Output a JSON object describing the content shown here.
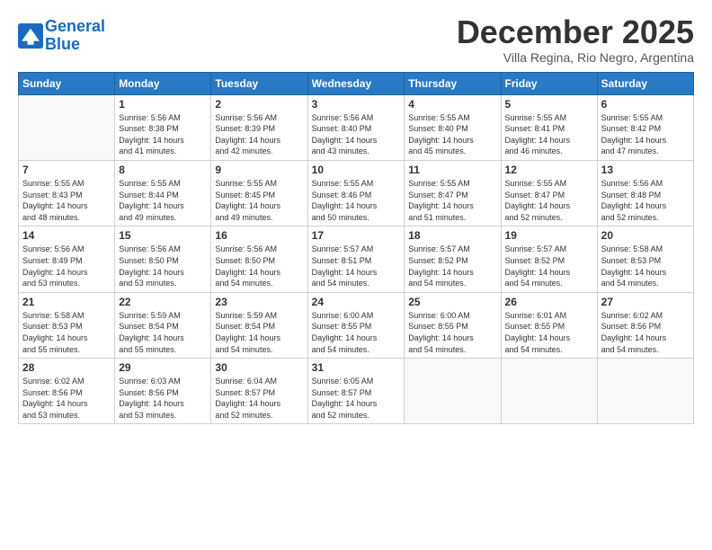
{
  "logo": {
    "line1": "General",
    "line2": "Blue"
  },
  "title": "December 2025",
  "subtitle": "Villa Regina, Rio Negro, Argentina",
  "header_days": [
    "Sunday",
    "Monday",
    "Tuesday",
    "Wednesday",
    "Thursday",
    "Friday",
    "Saturday"
  ],
  "weeks": [
    [
      {
        "day": "",
        "info": ""
      },
      {
        "day": "1",
        "info": "Sunrise: 5:56 AM\nSunset: 8:38 PM\nDaylight: 14 hours\nand 41 minutes."
      },
      {
        "day": "2",
        "info": "Sunrise: 5:56 AM\nSunset: 8:39 PM\nDaylight: 14 hours\nand 42 minutes."
      },
      {
        "day": "3",
        "info": "Sunrise: 5:56 AM\nSunset: 8:40 PM\nDaylight: 14 hours\nand 43 minutes."
      },
      {
        "day": "4",
        "info": "Sunrise: 5:55 AM\nSunset: 8:40 PM\nDaylight: 14 hours\nand 45 minutes."
      },
      {
        "day": "5",
        "info": "Sunrise: 5:55 AM\nSunset: 8:41 PM\nDaylight: 14 hours\nand 46 minutes."
      },
      {
        "day": "6",
        "info": "Sunrise: 5:55 AM\nSunset: 8:42 PM\nDaylight: 14 hours\nand 47 minutes."
      }
    ],
    [
      {
        "day": "7",
        "info": "Sunrise: 5:55 AM\nSunset: 8:43 PM\nDaylight: 14 hours\nand 48 minutes."
      },
      {
        "day": "8",
        "info": "Sunrise: 5:55 AM\nSunset: 8:44 PM\nDaylight: 14 hours\nand 49 minutes."
      },
      {
        "day": "9",
        "info": "Sunrise: 5:55 AM\nSunset: 8:45 PM\nDaylight: 14 hours\nand 49 minutes."
      },
      {
        "day": "10",
        "info": "Sunrise: 5:55 AM\nSunset: 8:46 PM\nDaylight: 14 hours\nand 50 minutes."
      },
      {
        "day": "11",
        "info": "Sunrise: 5:55 AM\nSunset: 8:47 PM\nDaylight: 14 hours\nand 51 minutes."
      },
      {
        "day": "12",
        "info": "Sunrise: 5:55 AM\nSunset: 8:47 PM\nDaylight: 14 hours\nand 52 minutes."
      },
      {
        "day": "13",
        "info": "Sunrise: 5:56 AM\nSunset: 8:48 PM\nDaylight: 14 hours\nand 52 minutes."
      }
    ],
    [
      {
        "day": "14",
        "info": "Sunrise: 5:56 AM\nSunset: 8:49 PM\nDaylight: 14 hours\nand 53 minutes."
      },
      {
        "day": "15",
        "info": "Sunrise: 5:56 AM\nSunset: 8:50 PM\nDaylight: 14 hours\nand 53 minutes."
      },
      {
        "day": "16",
        "info": "Sunrise: 5:56 AM\nSunset: 8:50 PM\nDaylight: 14 hours\nand 54 minutes."
      },
      {
        "day": "17",
        "info": "Sunrise: 5:57 AM\nSunset: 8:51 PM\nDaylight: 14 hours\nand 54 minutes."
      },
      {
        "day": "18",
        "info": "Sunrise: 5:57 AM\nSunset: 8:52 PM\nDaylight: 14 hours\nand 54 minutes."
      },
      {
        "day": "19",
        "info": "Sunrise: 5:57 AM\nSunset: 8:52 PM\nDaylight: 14 hours\nand 54 minutes."
      },
      {
        "day": "20",
        "info": "Sunrise: 5:58 AM\nSunset: 8:53 PM\nDaylight: 14 hours\nand 54 minutes."
      }
    ],
    [
      {
        "day": "21",
        "info": "Sunrise: 5:58 AM\nSunset: 8:53 PM\nDaylight: 14 hours\nand 55 minutes."
      },
      {
        "day": "22",
        "info": "Sunrise: 5:59 AM\nSunset: 8:54 PM\nDaylight: 14 hours\nand 55 minutes."
      },
      {
        "day": "23",
        "info": "Sunrise: 5:59 AM\nSunset: 8:54 PM\nDaylight: 14 hours\nand 54 minutes."
      },
      {
        "day": "24",
        "info": "Sunrise: 6:00 AM\nSunset: 8:55 PM\nDaylight: 14 hours\nand 54 minutes."
      },
      {
        "day": "25",
        "info": "Sunrise: 6:00 AM\nSunset: 8:55 PM\nDaylight: 14 hours\nand 54 minutes."
      },
      {
        "day": "26",
        "info": "Sunrise: 6:01 AM\nSunset: 8:55 PM\nDaylight: 14 hours\nand 54 minutes."
      },
      {
        "day": "27",
        "info": "Sunrise: 6:02 AM\nSunset: 8:56 PM\nDaylight: 14 hours\nand 54 minutes."
      }
    ],
    [
      {
        "day": "28",
        "info": "Sunrise: 6:02 AM\nSunset: 8:56 PM\nDaylight: 14 hours\nand 53 minutes."
      },
      {
        "day": "29",
        "info": "Sunrise: 6:03 AM\nSunset: 8:56 PM\nDaylight: 14 hours\nand 53 minutes."
      },
      {
        "day": "30",
        "info": "Sunrise: 6:04 AM\nSunset: 8:57 PM\nDaylight: 14 hours\nand 52 minutes."
      },
      {
        "day": "31",
        "info": "Sunrise: 6:05 AM\nSunset: 8:57 PM\nDaylight: 14 hours\nand 52 minutes."
      },
      {
        "day": "",
        "info": ""
      },
      {
        "day": "",
        "info": ""
      },
      {
        "day": "",
        "info": ""
      }
    ]
  ]
}
